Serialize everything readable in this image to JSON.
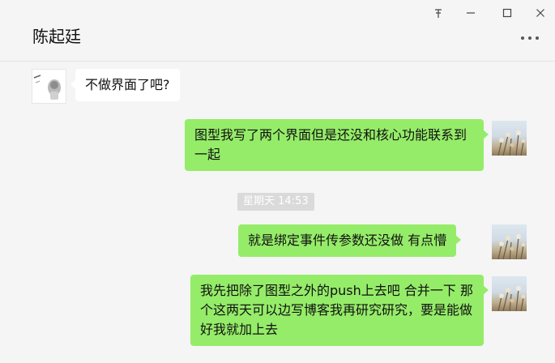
{
  "window": {
    "title": "陈起廷",
    "pin_icon": "pin-icon",
    "minimize_icon": "minimize-icon",
    "maximize_icon": "maximize-icon",
    "close_icon": "close-icon",
    "more_icon": "more-dots-icon"
  },
  "messages": [
    {
      "sender": "peer",
      "text": "不做界面了吧?"
    },
    {
      "sender": "self",
      "text": "图型我写了两个界面但是还没和核心功能联系到一起"
    },
    {
      "sender": "self",
      "text": "就是绑定事件传参数还没做 有点懵"
    },
    {
      "sender": "self",
      "text": "我先把除了图型之外的push上去吧 合并一下 那个这两天可以边写博客我再研究研究，要是能做好我就加上去"
    }
  ],
  "timestamp": "星期天 14:53",
  "colors": {
    "self_bubble": "#95ec69",
    "peer_bubble": "#ffffff",
    "background": "#f5f5f5"
  }
}
